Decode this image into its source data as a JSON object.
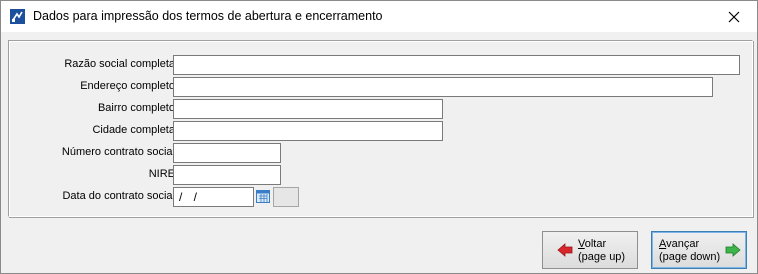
{
  "window": {
    "title": "Dados para impressão dos termos de abertura e encerramento",
    "close_glyph": "✕"
  },
  "form": {
    "fields": [
      {
        "label": "Razão social completa",
        "value": ""
      },
      {
        "label": "Endereço completo",
        "value": ""
      },
      {
        "label": "Bairro completo",
        "value": ""
      },
      {
        "label": "Cidade completa",
        "value": ""
      },
      {
        "label": "Número contrato social",
        "value": ""
      },
      {
        "label": "NIRE",
        "value": ""
      },
      {
        "label": "Data do contrato social",
        "value": "/ /"
      }
    ]
  },
  "buttons": {
    "back": {
      "key": "V",
      "rest": "oltar",
      "sub": "(page up)",
      "icon": "arrow-left-icon",
      "color": "#d9262b"
    },
    "next": {
      "key": "A",
      "rest": "vançar",
      "sub": "(page down)",
      "icon": "arrow-right-icon",
      "color": "#3db54a"
    }
  },
  "colors": {
    "accent": "#1f5fbf",
    "panel": "#f0f0f0"
  }
}
